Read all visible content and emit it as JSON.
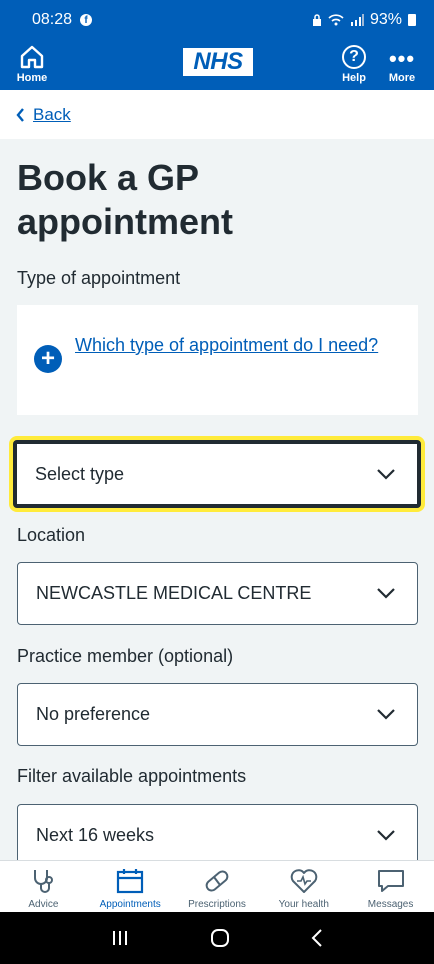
{
  "status_bar": {
    "time": "08:28",
    "fb_badge": "f",
    "battery": "93%"
  },
  "header": {
    "home_label": "Home",
    "logo_text": "NHS",
    "help_label": "Help",
    "more_label": "More",
    "help_glyph": "?",
    "more_glyph": "•••"
  },
  "back": {
    "label": "Back"
  },
  "page": {
    "title": "Book a GP appointment"
  },
  "form": {
    "type_label": "Type of appointment",
    "info_link": "Which type of appointment do I need?",
    "info_icon": "+",
    "type_select_value": "Select type",
    "location_label": "Location",
    "location_value": "NEWCASTLE MEDICAL CENTRE",
    "member_label": "Practice member (optional)",
    "member_value": "No preference",
    "filter_label": "Filter available appointments",
    "filter_value": "Next 16 weeks"
  },
  "bottom_nav": [
    {
      "label": "Advice",
      "icon": "stethoscope-icon",
      "active": false
    },
    {
      "label": "Appointments",
      "icon": "calendar-icon",
      "active": true
    },
    {
      "label": "Prescriptions",
      "icon": "pill-icon",
      "active": false
    },
    {
      "label": "Your health",
      "icon": "heart-icon",
      "active": false
    },
    {
      "label": "Messages",
      "icon": "message-icon",
      "active": false
    }
  ],
  "colors": {
    "nhs_blue": "#005eb8",
    "focus_yellow": "#ffeb3b",
    "background": "#f0f4f5",
    "text": "#212b32"
  }
}
